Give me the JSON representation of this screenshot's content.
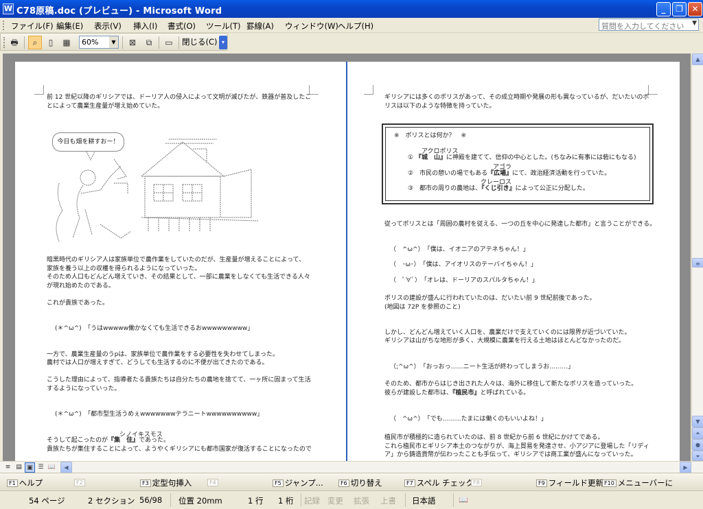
{
  "window": {
    "title": "C78原稿.doc (プレビュー) - Microsoft Word",
    "app_icon": "W"
  },
  "menu": {
    "items": [
      "ファイル(F)",
      "編集(E)",
      "表示(V)",
      "挿入(I)",
      "書式(O)",
      "ツール(T)",
      "罫線(A)",
      "ウィンドウ(W)",
      "ヘルプ(H)"
    ],
    "ask_placeholder": "質問を入力してください"
  },
  "toolbar": {
    "zoom": "60%",
    "close_label": "閉じる(C)"
  },
  "left_page": {
    "intro_1": "前 12 世紀以降のギリシアでは、ドーリア人の侵入によって文明が滅びたが、鉄器が普及したこ",
    "intro_2": "とによって農業生産量が増え始めていた。",
    "bubble": "今日も畑を耕すおー！",
    "p2_1": "暗黒時代のギリシア人は家族単位で農作業をしていたのだが、生産量が増えることによって、",
    "p2_2": "家族を養う以上の収穫を得られるようになっていった。",
    "p2_3": "そのため人口もどんどん増えていき、その結果として、一部に農業をしなくても生活できる人々",
    "p2_4": "が現れ始めたのである。",
    "p3": "これが貴族であった。",
    "quote1": "(＊^ω^)　「うはwwwww働かなくても生活できるおwwwwwwwww」",
    "p4_1": "一方で、農業生産量のうpは、家族単位で農作業をする必要性を失わせてしまった。",
    "p4_2": "農村では人口が増えすぎて、どうしても生活するのに不便が出てきたのである。",
    "p5_1": "こうした理由によって、指導者たる貴族たちは自分たちの農地を捨てて、一ヶ所に固まって生活",
    "p5_2": "するようになっていった。",
    "quote2": "(＊^ω^)　「都市型生活うめぇwwwwwwwテラニートwwwwwwwwww」",
    "p6_ruby": "シノイキスモス",
    "p6_1a": "そうして起こったのが",
    "p6_1b": "『集　住』",
    "p6_1c": "であった。",
    "p6_2": "貴族たちが集住することによって、ようやくギリシアにも都市国家が復活することになったので"
  },
  "right_page": {
    "intro_1": "ギリシアには多くのポリスがあって、その成立時期や発展の形も異なっているが、だいたいのポ",
    "intro_2": "リスは以下のような特徴を持っていた。",
    "box_title": "※　ポリスとは何か？　※",
    "ruby1": "アクロポリス",
    "item1_pre": "①",
    "item1_key": "『城　山』",
    "item1_rest": "に神殿を建てて、信仰の中心とした。(ちなみに有事には砦にもなる)",
    "ruby2": "アゴラ",
    "item2_pre": "②　市民の憩いの場でもある",
    "item2_key": "『広場』",
    "item2_rest": "にて、政治経済活動を行っていた。",
    "ruby3": "クレーロス",
    "item3_pre": "③　都市の周りの農地は、",
    "item3_key": "『くじ引き』",
    "item3_rest": "によって公正に分配した。",
    "p2": "従ってポリスとは「周囲の農村を従える、一つの丘を中心に発達した都市」と言うことができる。",
    "q1": "（　^ω^）　「僕は、イオニアのアテネちゃん！」",
    "q2": "（　･ω･）　「僕は、アイオリスのテーバイちゃん！」",
    "q3": "（　ﾟ∀ﾟ）　「オレは、ドーリアのスパルタちゃん！」",
    "p3_1": "ポリスの建設が盛んに行われていたのは、だいたい前 9 世紀前後であった。",
    "p3_2": "(地図は 72P を参照のこと)",
    "p4_1": "しかし、どんどん増えていく人口を、農業だけで支えていくのには限界が近づいていた。",
    "p4_2": "ギリシアは山がちな地形が多く、大規模に農業を行える土地はほとんどなかったのだ。",
    "q4": "（;^ω^）　「おっおっ……ニート生活が終わってしまうお………」",
    "p5_1": "そのため、都市からはじき出された人々は、海外に移住して新たなポリスを造っていった。",
    "p5_2a": "彼らが建設した都市は、",
    "p5_2b": "『植民市』",
    "p5_2c": "と呼ばれている。",
    "q5": "（　^ω^）　「でも………たまには働くのもいいよね！」",
    "p6_1": "植民市が積極的に造られていたのは、前 8 世紀から前 6 世紀にかけてである。",
    "p6_2": "これら植民市とギリシア本土のつながりが、海上貿易を発達させ、小アジアに登場した「リディ",
    "p6_3": "ア」から鋳造貨幣が伝わったことも手伝って、ギリシアでは商工業が盛んになっていった。"
  },
  "fkeys": [
    {
      "key": "F1",
      "label": "ヘルプ",
      "enabled": true
    },
    {
      "key": "F2",
      "label": "",
      "enabled": false
    },
    {
      "key": "F3",
      "label": "定型句挿入",
      "enabled": true
    },
    {
      "key": "F4",
      "label": "",
      "enabled": false
    },
    {
      "key": "F5",
      "label": "ジャンプ...",
      "enabled": true
    },
    {
      "key": "F6",
      "label": "切り替え",
      "enabled": true
    },
    {
      "key": "F7",
      "label": "スペル チェック...",
      "enabled": true
    },
    {
      "key": "F8",
      "label": "",
      "enabled": false
    },
    {
      "key": "F9",
      "label": "フィールド更新",
      "enabled": true
    },
    {
      "key": "F10",
      "label": "メニューバーに",
      "enabled": true
    }
  ],
  "status": {
    "page": "54 ページ",
    "section": "2 セクション",
    "pages": "56/98",
    "position": "位置 20mm",
    "line": "1 行",
    "column": "1 桁",
    "rec": "記録",
    "trk": "変更",
    "ext": "拡張",
    "ovr": "上書",
    "lang": "日本語"
  }
}
